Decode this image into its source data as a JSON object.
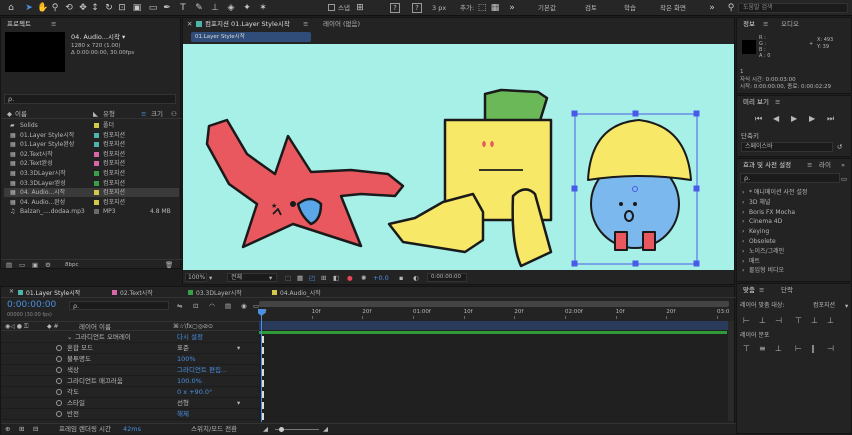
{
  "toolbar": {
    "snap_label": "스냅",
    "align_label": "3 px",
    "default_label": "기본값",
    "learn_label": "학습",
    "small_screen_label": "작은 화면",
    "add_label": "추가:",
    "search_placeholder": "도움말 검색",
    "review_label": "검토"
  },
  "project": {
    "panel_title": "프로젝트",
    "comp_name": "04. Audio...시작 ▾",
    "comp_res": "1280 x 720 (1.00)",
    "comp_time": "Δ 0:00:00:00, 30.00fps",
    "search_label": "ρ.",
    "col_name": "이름",
    "col_type": "유형",
    "col_size": "크기",
    "items": [
      {
        "name": "Solids",
        "type": "폴더",
        "color": "#d4c84a",
        "size": ""
      },
      {
        "name": "01.Layer Style시작",
        "type": "컴포지션",
        "color": "#4cb4a8",
        "size": ""
      },
      {
        "name": "01.Layer Style완성",
        "type": "컴포지션",
        "color": "#4cb4a8",
        "size": ""
      },
      {
        "name": "02.Text시작",
        "type": "컴포지션",
        "color": "#d866a8",
        "size": ""
      },
      {
        "name": "02.Text완성",
        "type": "컴포지션",
        "color": "#d866a8",
        "size": ""
      },
      {
        "name": "03.3DLayer시작",
        "type": "컴포지션",
        "color": "#3a9e46",
        "size": ""
      },
      {
        "name": "03.3DLayer완성",
        "type": "컴포지션",
        "color": "#3a9e46",
        "size": ""
      },
      {
        "name": "04. Audio...시작",
        "type": "컴포지션",
        "color": "#d4c84a",
        "size": "",
        "selected": true
      },
      {
        "name": "04. Audio...완성",
        "type": "컴포지션",
        "color": "#d4c84a",
        "size": ""
      },
      {
        "name": "Balzan_....dodaa.mp3",
        "type": "MP3",
        "color": "#6a6a6a",
        "size": "4.8 MB"
      }
    ],
    "bpc_label": "8bpc"
  },
  "composition": {
    "panel_title": "컴포지션 01.Layer Style시작",
    "layer_tab": "레이어 (없음)",
    "breadcrumb": "01.Layer Style시작",
    "zoom": "100%",
    "resolution": "전체",
    "timecode": "0:00:00:00",
    "exposure": "+0.0"
  },
  "info": {
    "panel_title": "정보",
    "audio_title": "오디오",
    "rgba": [
      "R :",
      "G :",
      "B :",
      "A : 0"
    ],
    "x": "X: 493",
    "y": "Y: 39",
    "comp_label": "1",
    "start": "자식 시간: 0:00:03:00",
    "time": "시작: 0:00:00:00, 종료: 0:00:02:29"
  },
  "preview": {
    "panel_title": "미리 보기",
    "shortcut_label": "단축키",
    "shortcut_value": "스페이스바"
  },
  "effects": {
    "panel_title": "효과 및 사전 설정",
    "library_title": "라이",
    "search_label": "ρ.",
    "items": [
      "* 애니메이션 사전 설정",
      "3D 채널",
      "Boris FX Mocha",
      "Cinema 4D",
      "Keying",
      "Obsolete",
      "노이즈/그레인",
      "매트",
      "몰입형 비디오"
    ]
  },
  "align": {
    "panel_title": "맞춤",
    "paragraph_title": "단락",
    "align_to_label": "레이어 맞춤 대상:",
    "align_to_value": "컴포지션",
    "distribute_label": "레이어 분포"
  },
  "timeline": {
    "tabs": [
      {
        "label": "01.Layer Style시작",
        "color": "#4cb4a8"
      },
      {
        "label": "02.Text시작",
        "color": "#d866a8"
      },
      {
        "label": "03.3DLayer시작",
        "color": "#3a9e46"
      },
      {
        "label": "04.Audio_시작",
        "color": "#d4c84a"
      }
    ],
    "timecode": "0:00:00:00",
    "fps": "00000 (30.00 fps)",
    "search_label": "ρ.",
    "layer_name_header": "레이어 이름",
    "ruler": [
      "0f",
      "10f",
      "20f",
      "01:00f",
      "10f",
      "20f",
      "02:00f",
      "10f",
      "20f",
      "03:0"
    ],
    "props": [
      {
        "name": "그라디언트 오버레이",
        "value": "다시 설정",
        "indent": 1,
        "value_style": "blue"
      },
      {
        "name": "혼합 모드",
        "value": "표준",
        "indent": 2,
        "value_style": "select"
      },
      {
        "name": "불투명도",
        "value": "100%",
        "indent": 2,
        "value_style": "blue"
      },
      {
        "name": "색상",
        "value": "그라디언트 편집...",
        "indent": 2,
        "value_style": "blue"
      },
      {
        "name": "그라디언트 매끄러움",
        "value": "100.0%",
        "indent": 2,
        "value_style": "blue"
      },
      {
        "name": "각도",
        "value": "0 x +90.0°",
        "indent": 2,
        "value_style": "blue"
      },
      {
        "name": "스타일",
        "value": "선형",
        "indent": 2,
        "value_style": "select"
      },
      {
        "name": "반전",
        "value": "해제",
        "indent": 2,
        "value_style": "blue"
      }
    ],
    "render_label": "프레임 렌더링 시간",
    "render_value": "42ms",
    "toggle_label": "스위치/모드 전환"
  }
}
